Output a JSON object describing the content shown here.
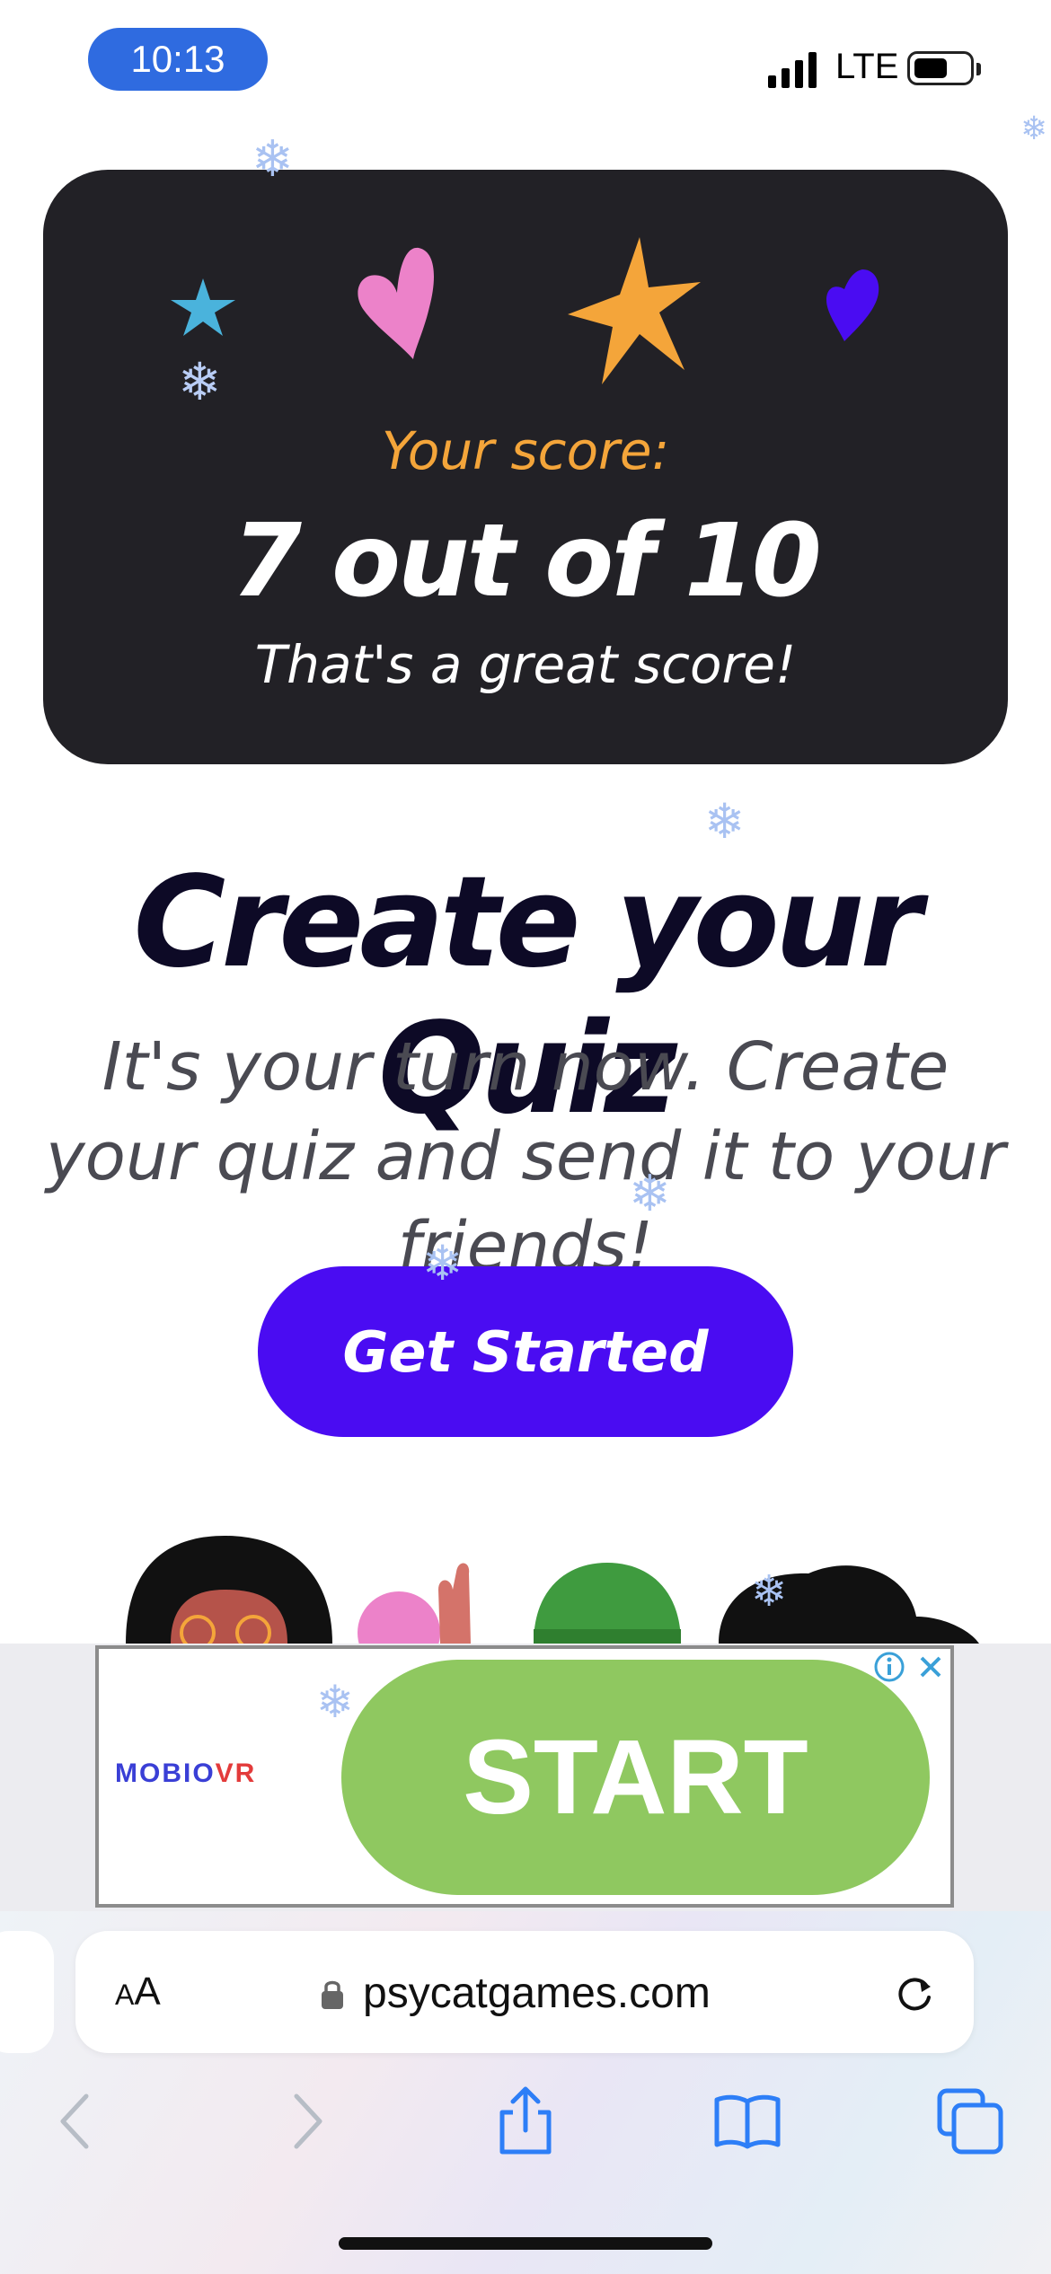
{
  "status_bar": {
    "time": "10:13",
    "network": "LTE"
  },
  "score_card": {
    "label": "Your score:",
    "value": "7 out of 10",
    "comment": "That's a great score!"
  },
  "create_section": {
    "title": "Create your Quiz",
    "description": "It's your turn now. Create your quiz and send it to your friends!",
    "button_label": "Get Started"
  },
  "ad": {
    "brand_main": "MOBIO",
    "brand_accent": "VR",
    "button_label": "START"
  },
  "browser": {
    "aa_big": "A",
    "aa_small": "A",
    "url": "psycatgames.com"
  },
  "colors": {
    "accent": "#4a0cf2",
    "card_bg": "#222126",
    "score_label": "#f4a53a",
    "ad_green": "#8fc860"
  }
}
